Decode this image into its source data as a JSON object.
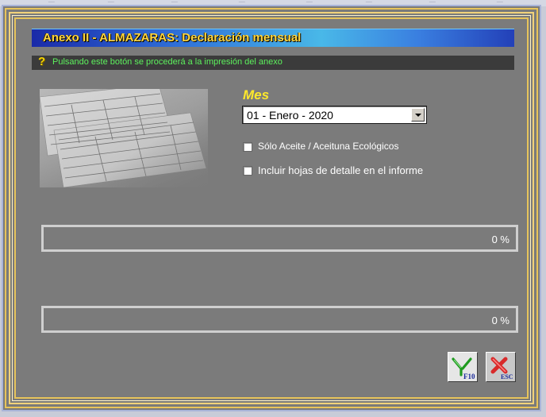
{
  "dialog": {
    "title": "Anexo II - ALMAZARAS: Declaración mensual",
    "hint_icon": "question-mark-icon",
    "hint": "Pulsando este botón se procederá a la impresión del anexo"
  },
  "form": {
    "month_label": "Mes",
    "month_value": "01  -  Enero  -  2020",
    "checkboxes": [
      {
        "label": "Sólo Aceite / Aceituna Ecológicos",
        "checked": false
      },
      {
        "label": "Incluir hojas de detalle en el informe",
        "checked": false
      }
    ]
  },
  "progress": [
    {
      "value": 0,
      "label": "0 %"
    },
    {
      "value": 0,
      "label": "0 %"
    }
  ],
  "buttons": {
    "print": {
      "icon": "print-fork-icon",
      "key": "F10"
    },
    "cancel": {
      "icon": "cancel-x-icon",
      "key": "ESC"
    }
  },
  "colors": {
    "title_text": "#ffd640",
    "hint_text": "#5df25d",
    "month_label": "#ffe92b",
    "frame_gold": "#e8c45a"
  }
}
